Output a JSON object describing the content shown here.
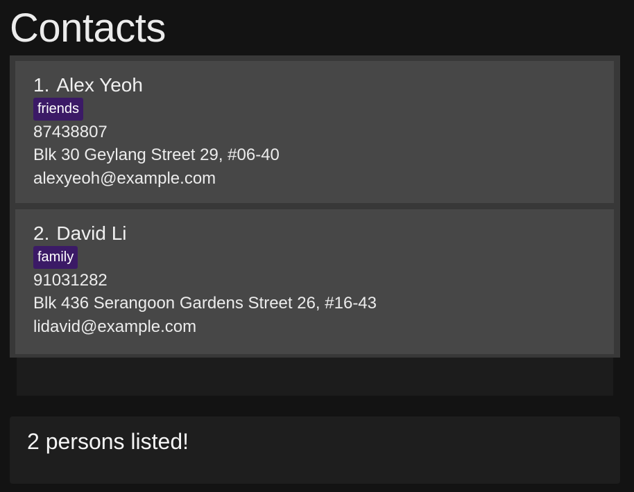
{
  "header": {
    "title": "Contacts"
  },
  "persons": [
    {
      "index": "1.",
      "name": "Alex Yeoh",
      "tag": "friends",
      "phone": "87438807",
      "address": "Blk 30 Geylang Street 29, #06-40",
      "email": "alexyeoh@example.com"
    },
    {
      "index": "2.",
      "name": "David Li",
      "tag": "family",
      "phone": "91031282",
      "address": "Blk 436 Serangoon Gardens Street 26, #16-43",
      "email": "lidavid@example.com"
    }
  ],
  "result": {
    "message": "2 persons listed!"
  },
  "colors": {
    "background": "#131313",
    "card": "#474747",
    "tag": "#3b1a66"
  }
}
